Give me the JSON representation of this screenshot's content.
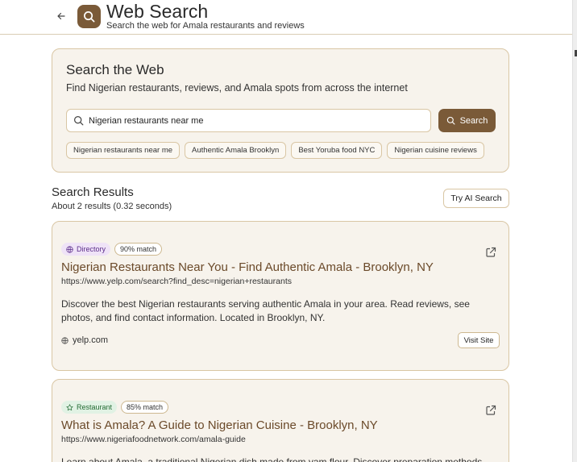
{
  "header": {
    "title": "Web Search",
    "subtitle": "Search the web for Amala restaurants and reviews",
    "back_icon": "arrow-left-icon",
    "logo_icon": "search-icon"
  },
  "search_panel": {
    "title": "Search the Web",
    "description": "Find Nigerian restaurants, reviews, and Amala spots from across the internet",
    "query": "Nigerian restaurants near me",
    "button_label": "Search",
    "suggestions": [
      "Nigerian restaurants near me",
      "Authentic Amala Brooklyn",
      "Best Yoruba food NYC",
      "Nigerian cuisine reviews"
    ]
  },
  "results": {
    "title": "Search Results",
    "count_text": "About 2 results (0.32 seconds)",
    "ai_button": "Try AI Search",
    "items": [
      {
        "category": "Directory",
        "category_icon": "globe-icon",
        "match": "90% match",
        "title": "Nigerian Restaurants Near You - Find Authentic Amala - Brooklyn, NY",
        "url": "https://www.yelp.com/search?find_desc=nigerian+restaurants",
        "description": "Discover the best Nigerian restaurants serving authentic Amala in your area. Read reviews, see photos, and find contact information. Located in Brooklyn, NY.",
        "domain": "yelp.com",
        "visit_label": "Visit Site"
      },
      {
        "category": "Restaurant",
        "category_icon": "star-icon",
        "match": "85% match",
        "title": "What is Amala? A Guide to Nigerian Cuisine - Brooklyn, NY",
        "url": "https://www.nigeriafoodnetwork.com/amala-guide",
        "description": "Learn about Amala, a traditional Nigerian dish made from yam flour. Discover preparation methods"
      }
    ]
  },
  "colors": {
    "accent": "#7a5a38",
    "card_bg": "#f7f3ec",
    "border": "#d9c6a4",
    "title_link": "#6b4a2a"
  }
}
